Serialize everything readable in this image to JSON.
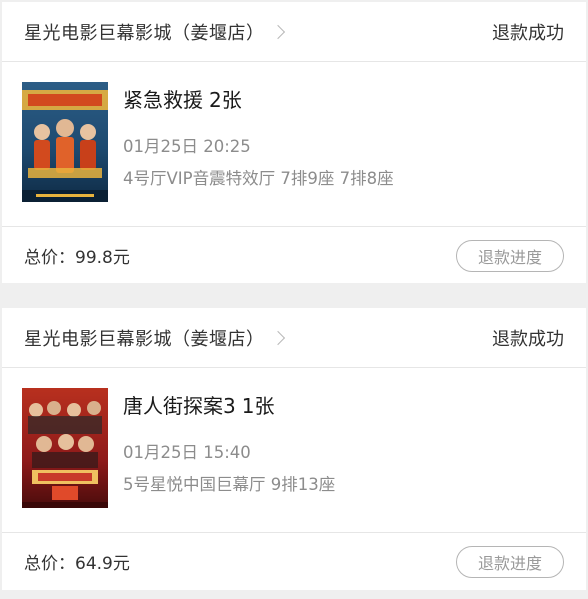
{
  "orders": [
    {
      "cinema": "星光电影巨幕影城（姜堰店）",
      "status": "退款成功",
      "movie_title": "紧急救援",
      "ticket_count": "2张",
      "show_time": "01月25日 20:25",
      "seats": "4号厅VIP音震特效厅 7排9座 7排8座",
      "total": "总价：99.8元",
      "button_label": "退款进度",
      "poster_colors": [
        "#1d4a70",
        "#d24a1e",
        "#e9b33d"
      ]
    },
    {
      "cinema": "星光电影巨幕影城（姜堰店）",
      "status": "退款成功",
      "movie_title": "唐人街探案3",
      "ticket_count": "1张",
      "show_time": "01月25日 15:40",
      "seats": "5号星悦中国巨幕厅 9排13座",
      "total": "总价：64.9元",
      "button_label": "退款进度",
      "poster_colors": [
        "#8e1a1a",
        "#c83a2a",
        "#f0c060"
      ]
    }
  ]
}
